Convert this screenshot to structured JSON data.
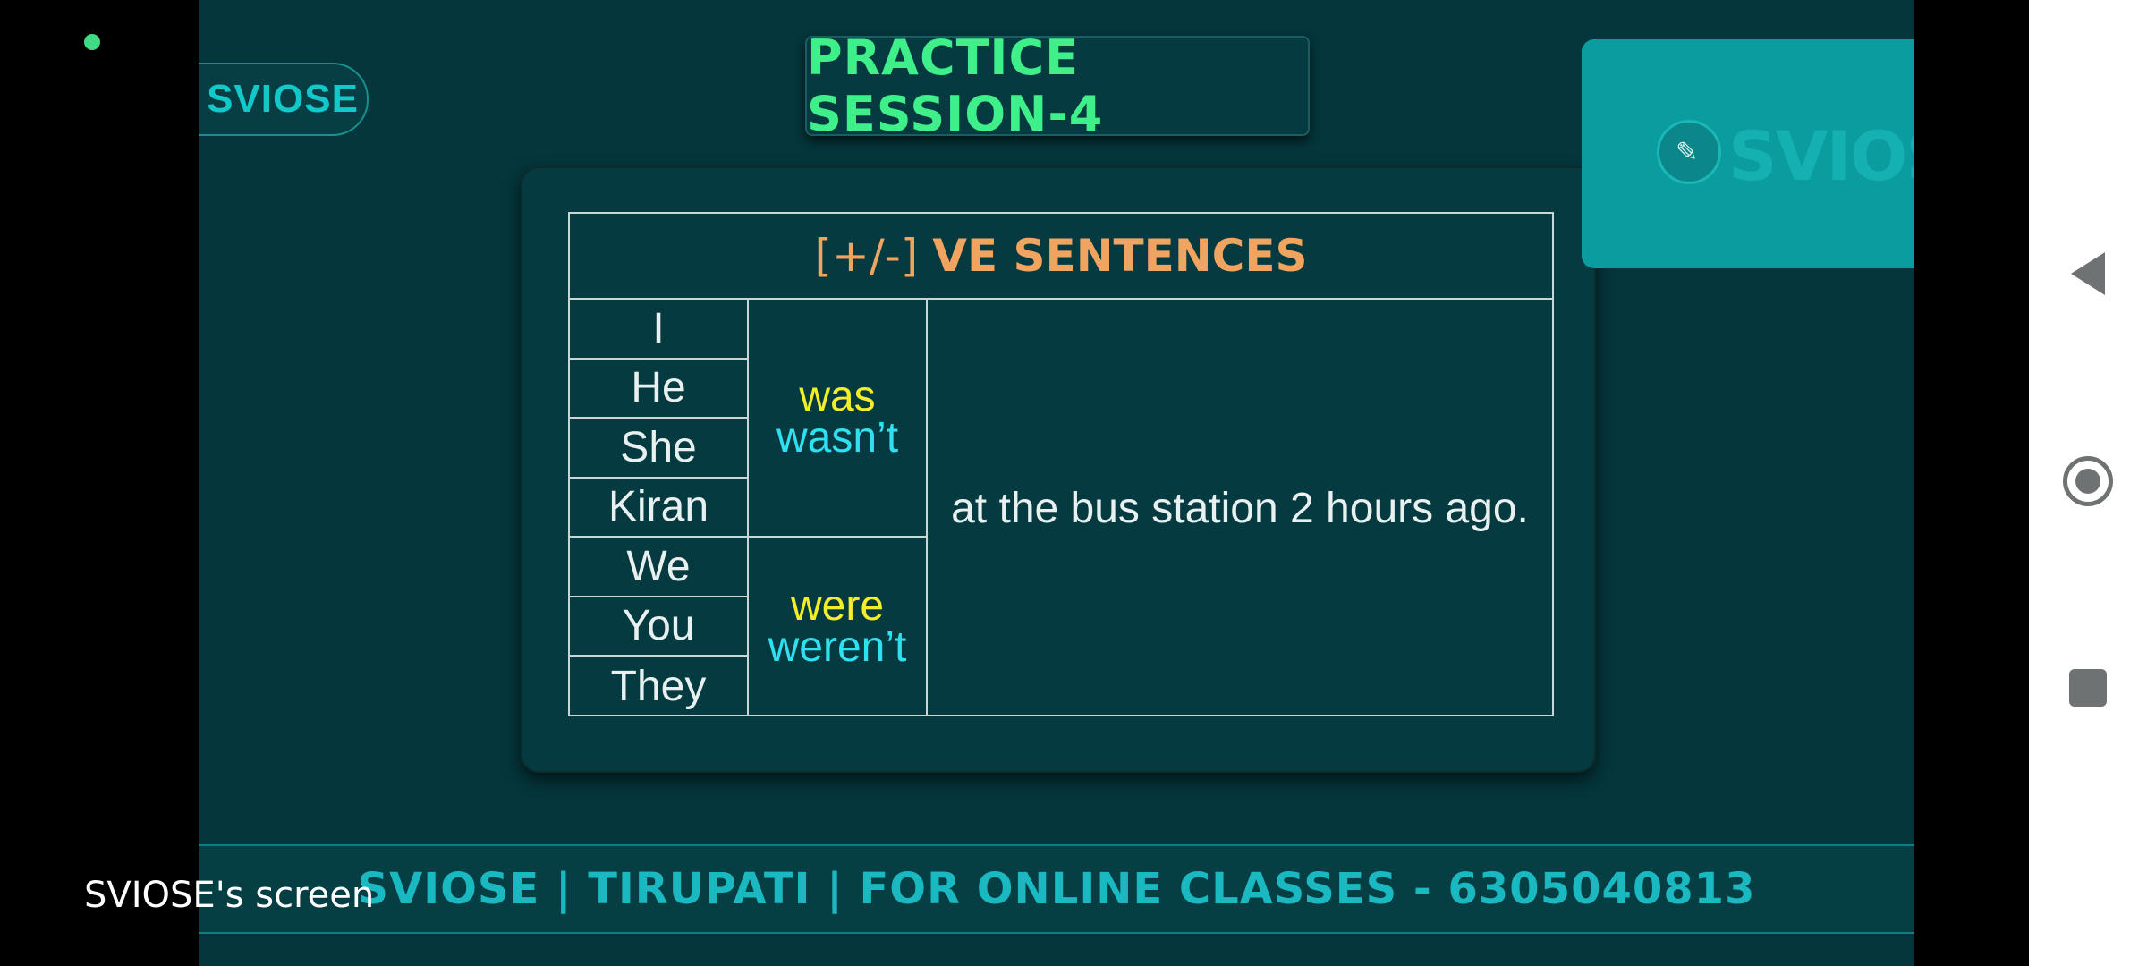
{
  "header": {
    "title": "PRACTICE SESSION-4",
    "brand_pill": "SVIOSE"
  },
  "table": {
    "header_bracket": "[+/-]",
    "header_text": "VE SENTENCES",
    "subjects": [
      "I",
      "He",
      "She",
      "Kiran",
      "We",
      "You",
      "They"
    ],
    "verbs": [
      {
        "positive": "was",
        "negative": "wasn’t"
      },
      {
        "positive": "were",
        "negative": "weren’t"
      }
    ],
    "phrase": "at the bus station 2 hours ago."
  },
  "thumbnail": {
    "logo_text": "SVIOSE"
  },
  "footer": {
    "text": "SVIOSE | TIRUPATI | FOR ONLINE CLASSES - 6305040813"
  },
  "screen_label": "SVIOSE's screen",
  "navbar": {
    "back_icon": "back-triangle-icon",
    "home_icon": "home-circle-icon",
    "recents_icon": "recents-square-icon"
  },
  "colors": {
    "background": "#04363b",
    "title": "#3ff08a",
    "header": "#f0a460",
    "positive": "#f2ee2a",
    "negative": "#2fe0f0",
    "footer": "#1ab8c0",
    "thumbnail": "#0a9c9f"
  }
}
